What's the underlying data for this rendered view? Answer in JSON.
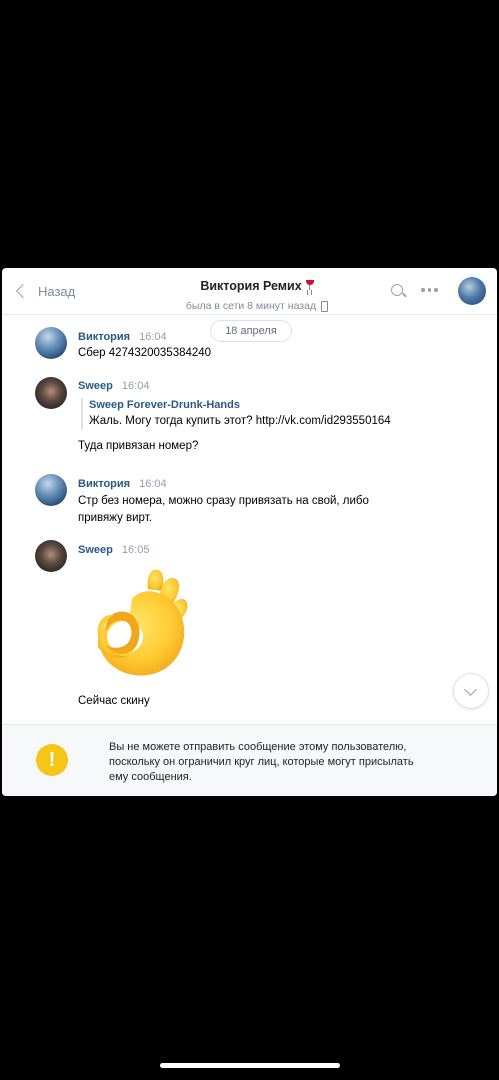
{
  "header": {
    "back_label": "Назад",
    "title": "Виктория Ремих",
    "status": "была в сети 8 минут назад"
  },
  "date_separator": "18 апреля",
  "messages": [
    {
      "author": "Виктория",
      "time": "16:04",
      "text": "Сбер 4274320035384240"
    },
    {
      "author": "Sweep",
      "time": "16:04",
      "quote_author": "Sweep Forever-Drunk-Hands",
      "quote_text": "Жаль. Могу тогда купить этот? http://vk.com/id293550164",
      "text": "Туда привязан номер?"
    },
    {
      "author": "Виктория",
      "time": "16:04",
      "text_line1": "Стр без номера, можно сразу привязать на свой, либо",
      "text_line2": "привяжу вирт."
    },
    {
      "author": "Sweep",
      "time": "16:05",
      "sticker": "ok-hand-emoji",
      "text": "Сейчас скину"
    }
  ],
  "notice": {
    "icon": "!",
    "line1": "Вы не можете отправить сообщение этому пользователю,",
    "line2": "поскольку он ограничил круг лиц, которые могут присылать",
    "line3": "ему сообщения."
  },
  "colors": {
    "link_blue": "#2a5885",
    "warning_yellow": "#f5c518",
    "muted_gray": "#828a99"
  }
}
